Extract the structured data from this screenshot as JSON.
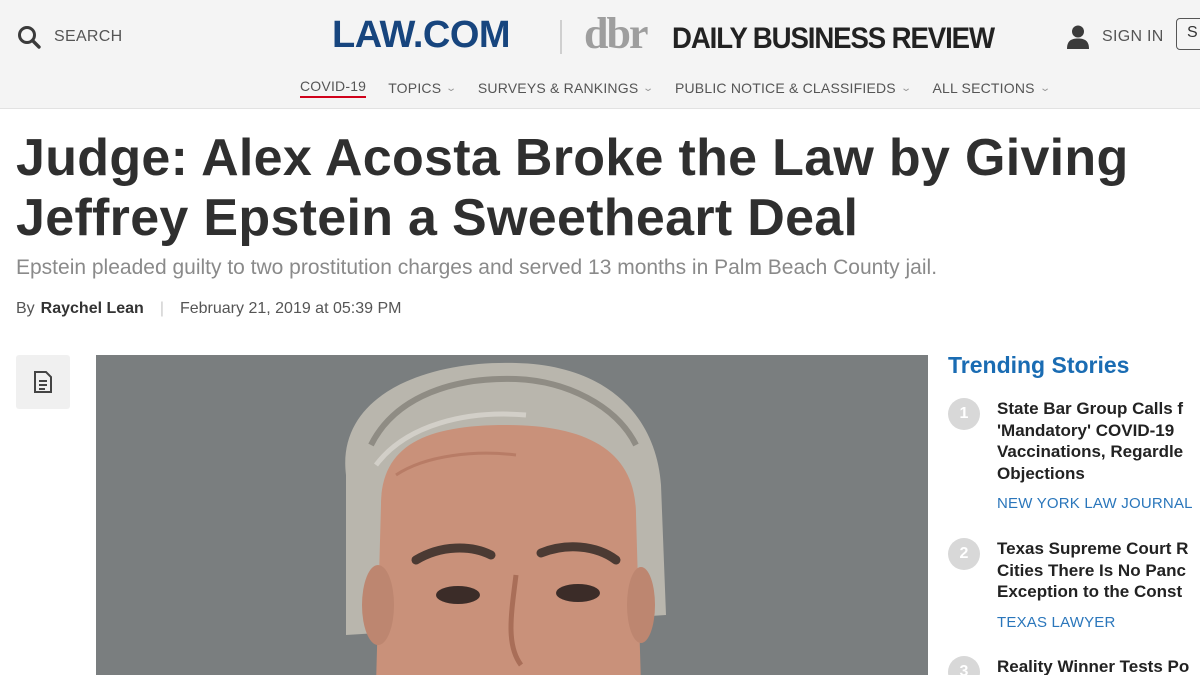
{
  "header": {
    "search_label": "SEARCH",
    "logo_primary": "LAW.COM",
    "logo_dbr": "dbr",
    "logo_publication": "DAILY BUSINESS REVIEW",
    "signin_label": "SIGN IN",
    "subscribe_stub": "S",
    "brand_color": "#17457e"
  },
  "nav": {
    "items": [
      {
        "label": "COVID-19"
      },
      {
        "label": "TOPICS"
      },
      {
        "label": "SURVEYS & RANKINGS"
      },
      {
        "label": "PUBLIC NOTICE & CLASSIFIEDS"
      },
      {
        "label": "ALL SECTIONS"
      }
    ],
    "active_color": "#d0021b"
  },
  "article": {
    "headline_line1": "Judge: Alex Acosta Broke the Law by Giving",
    "headline_line2": "Jeffrey Epstein a Sweetheart Deal",
    "dek": "Epstein pleaded guilty to two prostitution charges and served 13 months in Palm Beach County jail.",
    "by_prefix": "By",
    "author": "Raychel Lean",
    "separator": "|",
    "date": "February 21, 2019 at 05:39 PM",
    "doc_icon": "document-icon",
    "hero_image": "photo-portrait"
  },
  "sidebar": {
    "title": "Trending Stories",
    "accent": "#1a6cb3",
    "stories": [
      {
        "num": "1",
        "lines": [
          "State Bar Group Calls f",
          "'Mandatory' COVID-19",
          "Vaccinations, Regardle",
          "Objections"
        ],
        "source": "NEW YORK LAW JOURNAL"
      },
      {
        "num": "2",
        "lines": [
          "Texas Supreme Court R",
          "Cities There Is No Panc",
          "Exception to the Const"
        ],
        "source": "TEXAS LAWYER"
      },
      {
        "num": "3",
        "lines": [
          "Reality Winner Tests Po"
        ],
        "source": ""
      }
    ]
  }
}
